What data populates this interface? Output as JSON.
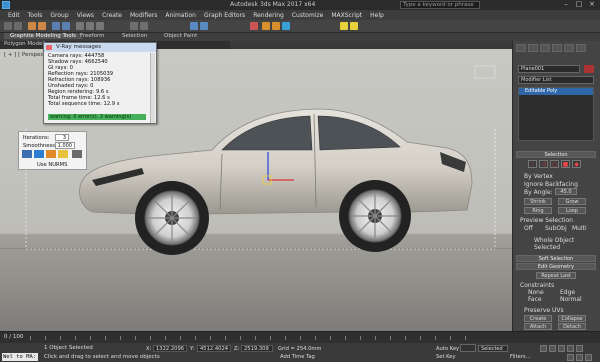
{
  "window": {
    "title": "Autodesk 3ds Max  2017 x64",
    "search_placeholder": "Type a keyword or phrase"
  },
  "menu": [
    "Edit",
    "Tools",
    "Group",
    "Views",
    "Create",
    "Modifiers",
    "Animation",
    "Graph Editors",
    "Rendering",
    "Customize",
    "MAXScript",
    "Help"
  ],
  "ribbon": {
    "tabs": [
      "Graphite Modeling Tools",
      "Freeform",
      "Selection",
      "Object Paint"
    ],
    "sublabel": "Polygon Modeling"
  },
  "viewport": {
    "label": "[ + ] [ Perspective ]"
  },
  "vray_messages": {
    "title": "V-Ray messages",
    "lines": [
      "Camera rays: 444758",
      "Shadow rays: 4662540",
      "GI rays: 0",
      "Reflection rays: 2105039",
      "Refraction rays: 108936",
      "Unshaded rays: 0",
      "Region rendering: 9.6 s",
      "Total frame time: 12.6 s",
      "Total sequence time: 12.9 s"
    ],
    "progress_text": "warning: 0 error(s), 2 warning(s)"
  },
  "iterations_panel": {
    "iterations_label": "Iterations:",
    "iterations_value": "3",
    "smoothness_label": "Smoothness:",
    "smoothness_value": "1.000",
    "use_nurms_label": "Use NURMS"
  },
  "command_panel": {
    "object_name": "Plane001",
    "modifier_list": "Modifier List",
    "stack_item": "Editable Poly",
    "selection_rollout": "Selection",
    "by_vertex": "By Vertex",
    "ignore_backfacing": "Ignore Backfacing",
    "by_angle": "By Angle:",
    "by_angle_value": "45.0",
    "shrink": "Shrink",
    "grow": "Grow",
    "ring": "Ring",
    "loop": "Loop",
    "preview_selection": "Preview Selection",
    "preview_off": "Off",
    "preview_subobj": "SubObj",
    "preview_multi": "Multi",
    "whole_object_selected": "Whole Object Selected",
    "soft_selection": "Soft Selection",
    "edit_geometry": "Edit Geometry",
    "repeat_last": "Repeat Last",
    "constraints": "Constraints",
    "c_none": "None",
    "c_edge": "Edge",
    "c_face": "Face",
    "c_normal": "Normal",
    "preserve_uvs": "Preserve UVs",
    "create": "Create",
    "collapse": "Collapse",
    "attach": "Attach",
    "detach": "Detach"
  },
  "timeline": {
    "frame": "0 / 100"
  },
  "status": {
    "maxscript": "Wel to MA:",
    "line1": "1 Object Selected",
    "line2": "Click and drag to select and move objects",
    "x_label": "X:",
    "x_value": "1322.2096",
    "y_label": "Y:",
    "y_value": "4512.4024",
    "z_label": "Z:",
    "z_value": "2519.309",
    "grid": "Grid = 254.0mm",
    "add_time_tag": "Add Time Tag",
    "auto_key": "Auto Key",
    "selected": "Selected",
    "set_key": "Set Key",
    "filters": "Filters..."
  }
}
